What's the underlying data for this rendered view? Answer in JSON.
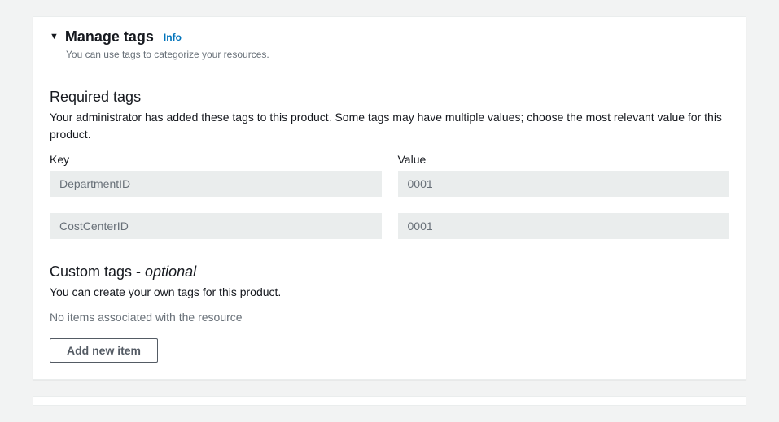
{
  "header": {
    "title": "Manage tags",
    "info_label": "Info",
    "subtitle": "You can use tags to categorize your resources."
  },
  "required": {
    "title": "Required tags",
    "description": "Your administrator has added these tags to this product. Some tags may have multiple values; choose the most relevant value for this product.",
    "key_header": "Key",
    "value_header": "Value",
    "rows": [
      {
        "key": "DepartmentID",
        "value": "0001"
      },
      {
        "key": "CostCenterID",
        "value": "0001"
      }
    ]
  },
  "custom": {
    "title_prefix": "Custom tags - ",
    "title_optional": "optional",
    "description": "You can create your own tags for this product.",
    "empty_message": "No items associated with the resource",
    "add_button": "Add new item"
  }
}
